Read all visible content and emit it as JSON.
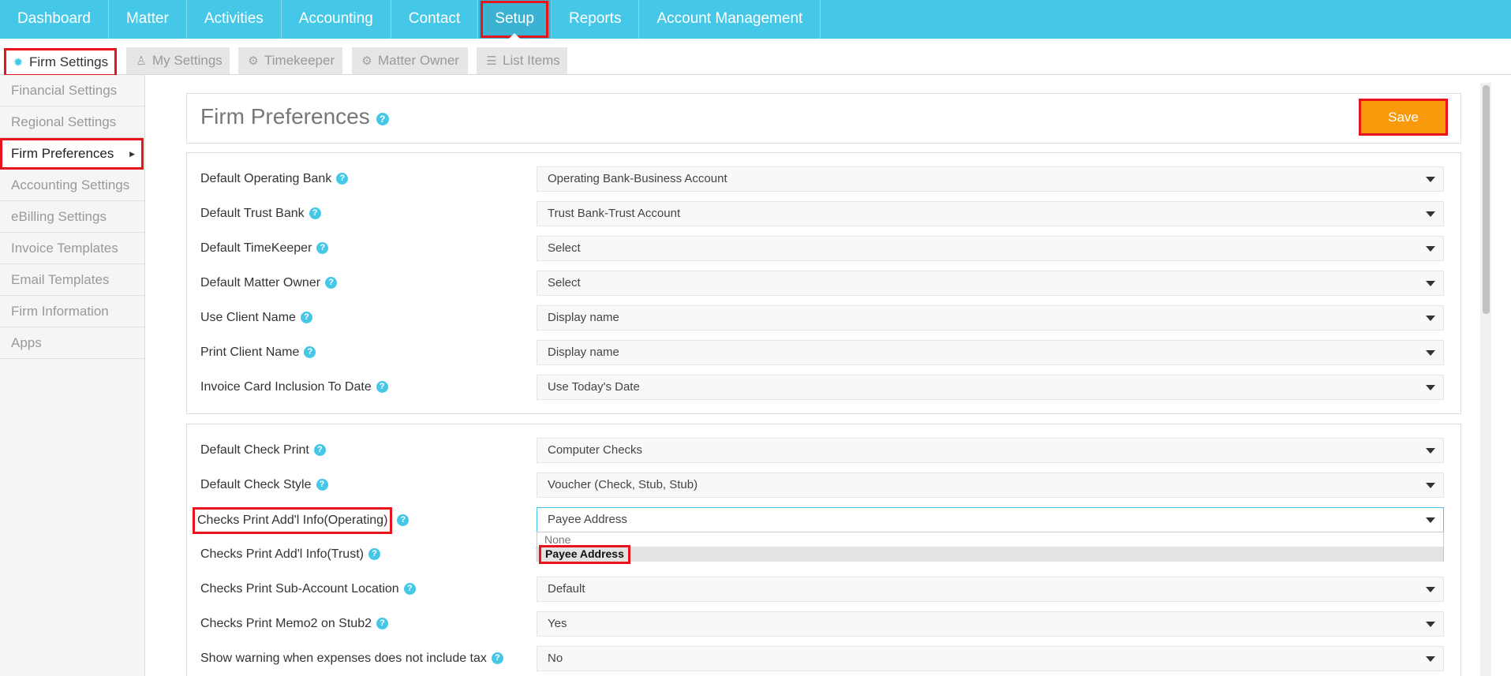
{
  "nav": {
    "items": [
      {
        "label": "Dashboard"
      },
      {
        "label": "Matter"
      },
      {
        "label": "Activities"
      },
      {
        "label": "Accounting"
      },
      {
        "label": "Contact"
      },
      {
        "label": "Setup"
      },
      {
        "label": "Reports"
      },
      {
        "label": "Account Management"
      }
    ],
    "active": "Setup"
  },
  "subtabs": [
    {
      "label": "Firm Settings",
      "icon": "gear-icon"
    },
    {
      "label": "My Settings",
      "icon": "person-icon"
    },
    {
      "label": "Timekeeper",
      "icon": "gears-icon"
    },
    {
      "label": "Matter Owner",
      "icon": "gear-icon"
    },
    {
      "label": "List Items",
      "icon": "list-icon"
    }
  ],
  "sidebar": {
    "items": [
      {
        "label": "Financial Settings"
      },
      {
        "label": "Regional Settings"
      },
      {
        "label": "Firm Preferences"
      },
      {
        "label": "Accounting Settings"
      },
      {
        "label": "eBilling Settings"
      },
      {
        "label": "Invoice Templates"
      },
      {
        "label": "Email Templates"
      },
      {
        "label": "Firm Information"
      },
      {
        "label": "Apps"
      }
    ],
    "active": "Firm Preferences"
  },
  "header": {
    "title": "Firm Preferences",
    "save_label": "Save"
  },
  "section1": [
    {
      "label": "Default Operating Bank",
      "value": "Operating Bank-Business Account"
    },
    {
      "label": "Default Trust Bank",
      "value": "Trust Bank-Trust Account"
    },
    {
      "label": "Default TimeKeeper",
      "value": "Select"
    },
    {
      "label": "Default Matter Owner",
      "value": "Select"
    },
    {
      "label": "Use Client Name",
      "value": "Display name"
    },
    {
      "label": "Print Client Name",
      "value": "Display name"
    },
    {
      "label": "Invoice Card Inclusion To Date",
      "value": "Use Today's Date"
    }
  ],
  "section2": [
    {
      "label": "Default Check Print",
      "value": "Computer Checks"
    },
    {
      "label": "Default Check Style",
      "value": "Voucher (Check, Stub, Stub)"
    },
    {
      "label": "Checks Print Add'l Info(Operating)",
      "value": "Payee Address"
    },
    {
      "label": "Checks Print Add'l Info(Trust)",
      "value": ""
    },
    {
      "label": "Checks Print Sub-Account Location",
      "value": "Default"
    },
    {
      "label": "Checks Print Memo2 on Stub2",
      "value": "Yes"
    },
    {
      "label": "Show warning when expenses does not include tax",
      "value": "No"
    }
  ],
  "dropdown": {
    "options": [
      "None",
      "Payee Address"
    ],
    "selected": "Payee Address"
  },
  "colors": {
    "nav_bg": "#45c8e8",
    "save_bg": "#f99a0b",
    "highlight": "#e8141c"
  }
}
